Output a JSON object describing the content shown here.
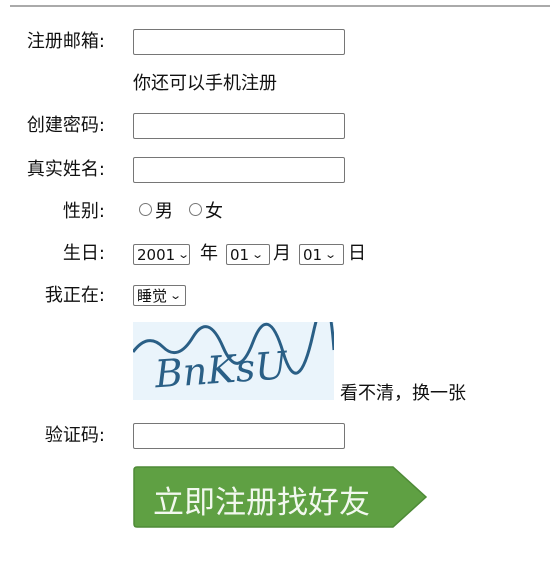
{
  "form": {
    "email_label": "注册邮箱:",
    "email_value": "",
    "phone_hint": "你还可以手机注册",
    "password_label": "创建密码:",
    "password_value": "",
    "name_label": "真实姓名:",
    "name_value": "",
    "gender_label": "性别:",
    "gender_options": [
      "男",
      "女"
    ],
    "birthday_label": "生日:",
    "year": "2001",
    "year_unit": "年",
    "month": "01",
    "month_unit": "月",
    "day": "01",
    "day_unit": "日",
    "activity_label": "我正在:",
    "activity": "睡觉",
    "captcha_text": "BnKsU",
    "refresh_captcha": "看不清，换一张",
    "verify_label": "验证码:",
    "verify_value": "",
    "submit_label": "立即注册找好友",
    "colors": {
      "submit_green": "#5fa043",
      "captcha_bg": "#eaf4fb",
      "captcha_ink": "#2a5f86"
    }
  }
}
